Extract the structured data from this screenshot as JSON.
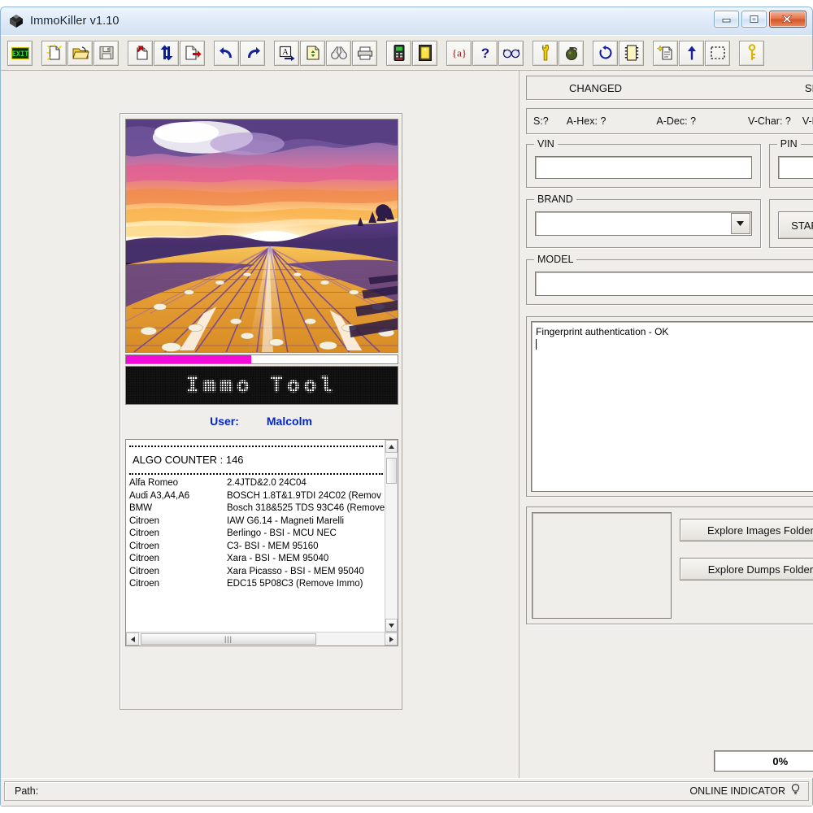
{
  "window": {
    "title": "ImmoKiller v1.10",
    "icon": "app-diamond-icon",
    "minimize_label": "Minimize",
    "maximize_label": "Maximize",
    "close_label": "Close"
  },
  "toolbar": {
    "buttons": [
      {
        "name": "exit-button",
        "icon": "exit-sign-icon",
        "label": "EXIT"
      },
      {
        "name": "new-file-button",
        "icon": "new-file-icon",
        "label": "New"
      },
      {
        "name": "open-file-button",
        "icon": "open-folder-icon",
        "label": "Open"
      },
      {
        "name": "save-file-button",
        "icon": "floppy-disk-icon",
        "label": "Save"
      },
      {
        "name": "read-eeprom-button",
        "icon": "file-arrow-in-icon",
        "label": "Read"
      },
      {
        "name": "transfer-button",
        "icon": "up-down-arrows-icon",
        "label": "Transfer"
      },
      {
        "name": "write-eeprom-button",
        "icon": "file-arrow-out-icon",
        "label": "Write"
      },
      {
        "name": "undo-button",
        "icon": "undo-arrow-icon",
        "label": "Undo"
      },
      {
        "name": "redo-button",
        "icon": "redo-arrow-icon",
        "label": "Redo"
      },
      {
        "name": "ascii-export-button",
        "icon": "a-arrow-icon",
        "label": "ASCII"
      },
      {
        "name": "compare-button",
        "icon": "file-swap-icon",
        "label": "Compare"
      },
      {
        "name": "find-button",
        "icon": "binoculars-icon",
        "label": "Find"
      },
      {
        "name": "print-button",
        "icon": "printer-icon",
        "label": "Print"
      },
      {
        "name": "device-button",
        "icon": "handheld-device-icon",
        "label": "Device"
      },
      {
        "name": "chip-button",
        "icon": "chip-icon",
        "label": "Chip"
      },
      {
        "name": "macro-button",
        "icon": "braces-a-icon",
        "label": "{a}"
      },
      {
        "name": "help-button",
        "icon": "question-mark-icon",
        "label": "?"
      },
      {
        "name": "glasses-button",
        "icon": "glasses-icon",
        "label": "View"
      },
      {
        "name": "wrench-button",
        "icon": "wrench-icon",
        "label": "Tools"
      },
      {
        "name": "grenade-button",
        "icon": "grenade-icon",
        "label": "Erase"
      },
      {
        "name": "refresh-button",
        "icon": "refresh-circle-icon",
        "label": "Refresh"
      },
      {
        "name": "memory-button",
        "icon": "memory-chip-icon",
        "label": "Memory"
      },
      {
        "name": "new-doc-magic-button",
        "icon": "sparkle-document-icon",
        "label": "Generate"
      },
      {
        "name": "up-arrow-button",
        "icon": "up-arrow-icon",
        "label": "Up"
      },
      {
        "name": "select-region-button",
        "icon": "dashed-selection-icon",
        "label": "Select"
      },
      {
        "name": "key-button",
        "icon": "key-icon",
        "label": "Key"
      }
    ]
  },
  "left_panel": {
    "splash_alt": "sunset-over-circuit-board-road",
    "progress_percent": 46,
    "led_display": "Immo Tool",
    "user_label": "User:",
    "user_name": "Malcolm",
    "algo_counter": "ALGO COUNTER : 146",
    "vehicle_rows": [
      {
        "brand": "Alfa Romeo",
        "desc": "2.4JTD&2.0    24C04"
      },
      {
        "brand": "Audi A3,A4,A6",
        "desc": "BOSCH 1.8T&1.9TDI   24C02 (Remov"
      },
      {
        "brand": "BMW",
        "desc": "Bosch 318&525 TDS 93C46 (Remove"
      },
      {
        "brand": "Citroen",
        "desc": "IAW G6.14 - Magneti Marelli"
      },
      {
        "brand": "Citroen",
        "desc": "Berlingo - BSI - MCU NEC"
      },
      {
        "brand": "Citroen",
        "desc": "C3- BSI - MEM 95160"
      },
      {
        "brand": "Citroen",
        "desc": "Xara - BSI - MEM 95040"
      },
      {
        "brand": "Citroen",
        "desc": "Xara Picasso     - BSI - MEM 95040"
      },
      {
        "brand": "Citroen",
        "desc": "EDC15 5P08C3 (Remove Immo)"
      }
    ]
  },
  "right_panel": {
    "changed_label": "CHANGED",
    "size_label": "SIZE",
    "stats": {
      "sel": "S:?",
      "a_hex": "A-Hex: ?",
      "a_dec": "A-Dec: ?",
      "v_char": "V-Char: ?",
      "v_dec": "V-Dec: ?"
    },
    "vin": {
      "title": "VIN",
      "value": "",
      "placeholder": ""
    },
    "pin": {
      "title": "PIN",
      "value": "",
      "placeholder": ""
    },
    "brand": {
      "title": "BRAND",
      "value": "",
      "placeholder": ""
    },
    "model": {
      "title": "MODEL",
      "value": "",
      "placeholder": ""
    },
    "start_button": "START",
    "log": {
      "line1": "Fingerprint authentication - OK"
    },
    "explore_images_button": "Explore Images Folder",
    "explore_dumps_button": "Explore Dumps Folder",
    "percent": "0%"
  },
  "statusbar": {
    "path_label": "Path:",
    "online_label": "ONLINE INDICATOR",
    "online_icon": "lightbulb-icon"
  },
  "colors": {
    "accent_magenta": "#f20ad8",
    "user_blue": "#0025d6",
    "face": "#efeeea",
    "title_gradient_top": "#eef5fc"
  }
}
